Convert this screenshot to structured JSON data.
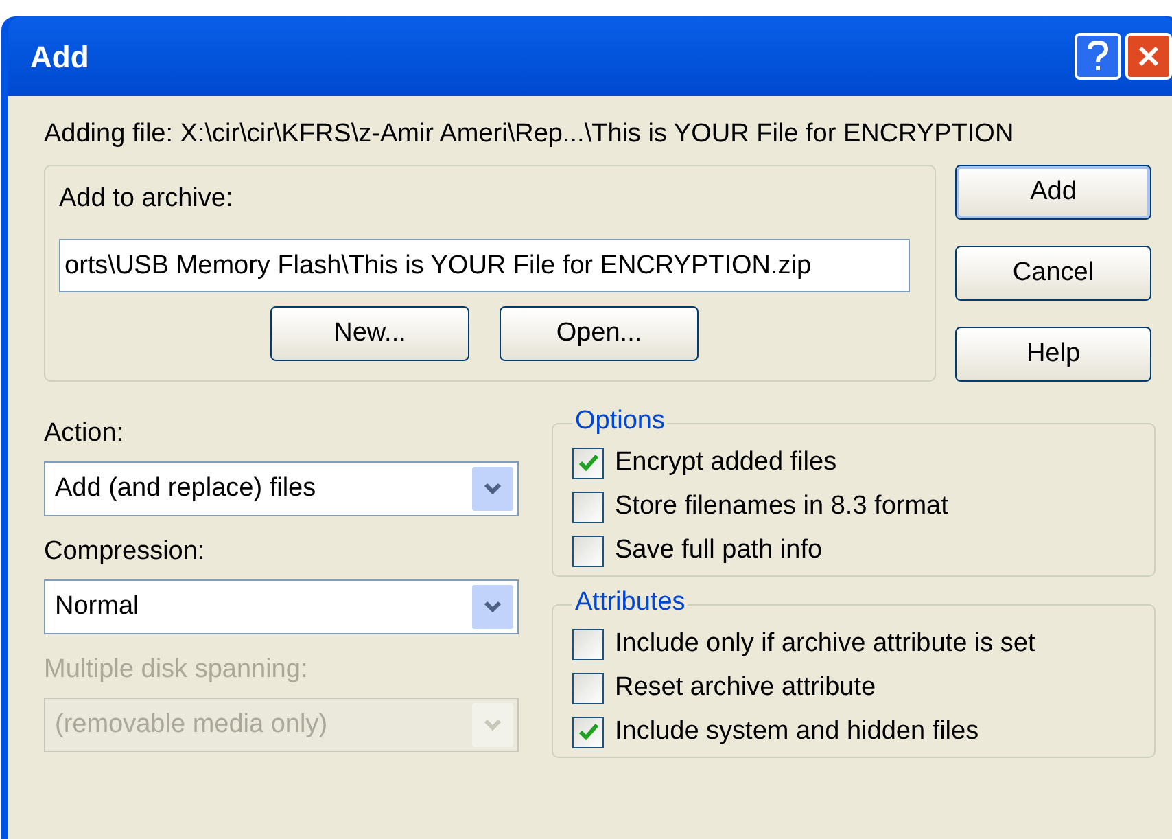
{
  "window": {
    "title": "Add"
  },
  "adding_file": "Adding file: X:\\cir\\cir\\KFRS\\z-Amir Ameri\\Rep...\\This is YOUR File for ENCRYPTION",
  "archive": {
    "label": "Add to archive:",
    "value": "orts\\USB Memory Flash\\This is YOUR File for ENCRYPTION.zip",
    "buttons": [
      "New...",
      "Open..."
    ]
  },
  "side_buttons": [
    {
      "label": "Add",
      "default": true
    },
    {
      "label": "Cancel",
      "default": false
    },
    {
      "label": "Help",
      "default": false
    }
  ],
  "fields": [
    {
      "label": "Action:",
      "value": "Add (and replace) files",
      "disabled": false
    },
    {
      "label": "Compression:",
      "value": "Normal",
      "disabled": false
    },
    {
      "label": "Multiple disk spanning:",
      "value": "(removable media only)",
      "disabled": true
    }
  ],
  "groups": [
    {
      "title": "Options",
      "items": [
        {
          "label": "Encrypt added files",
          "checked": true
        },
        {
          "label": "Store filenames in 8.3 format",
          "checked": false
        },
        {
          "label": "Save full path info",
          "checked": false
        }
      ]
    },
    {
      "title": "Attributes",
      "items": [
        {
          "label": "Include only if archive attribute is set",
          "checked": false
        },
        {
          "label": "Reset archive attribute",
          "checked": false
        },
        {
          "label": "Include system and hidden files",
          "checked": true
        }
      ]
    }
  ]
}
